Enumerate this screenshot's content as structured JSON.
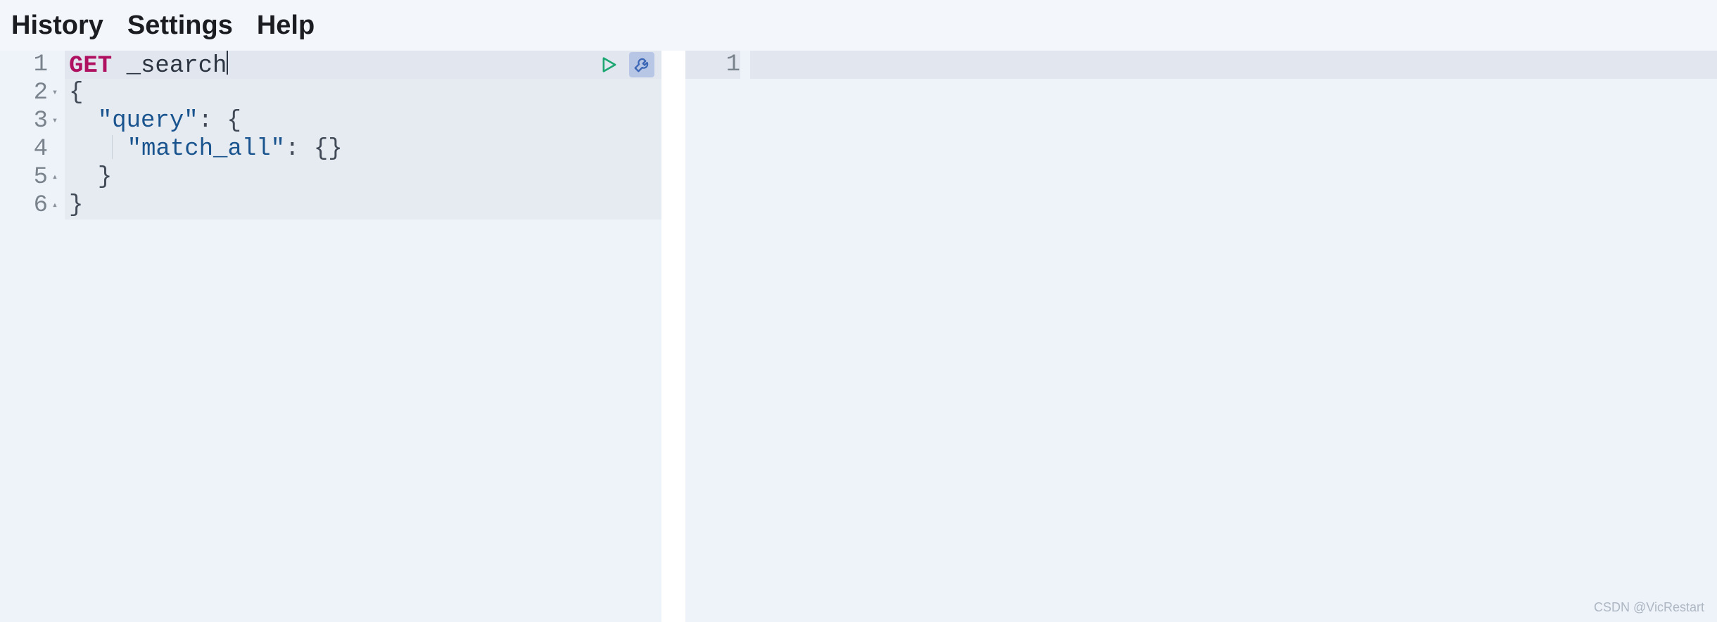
{
  "menu": {
    "history": "History",
    "settings": "Settings",
    "help": "Help"
  },
  "request": {
    "lines": [
      {
        "num": "1",
        "fold": "",
        "method": "GET",
        "path": "_search"
      },
      {
        "num": "2",
        "fold": "▾",
        "text": "{"
      },
      {
        "num": "3",
        "fold": "▾",
        "indent": "  ",
        "string": "\"query\"",
        "after": ": {"
      },
      {
        "num": "4",
        "fold": "",
        "indent": "    ",
        "guide": true,
        "string": "\"match_all\"",
        "after": ": {}"
      },
      {
        "num": "5",
        "fold": "▴",
        "indent": "  ",
        "text": "}"
      },
      {
        "num": "6",
        "fold": "▴",
        "text": "}"
      }
    ]
  },
  "response": {
    "lines": [
      {
        "num": "1",
        "text": ""
      }
    ]
  },
  "icons": {
    "run": "run-icon",
    "wrench": "wrench-icon"
  },
  "watermark": "CSDN @VicRestart"
}
